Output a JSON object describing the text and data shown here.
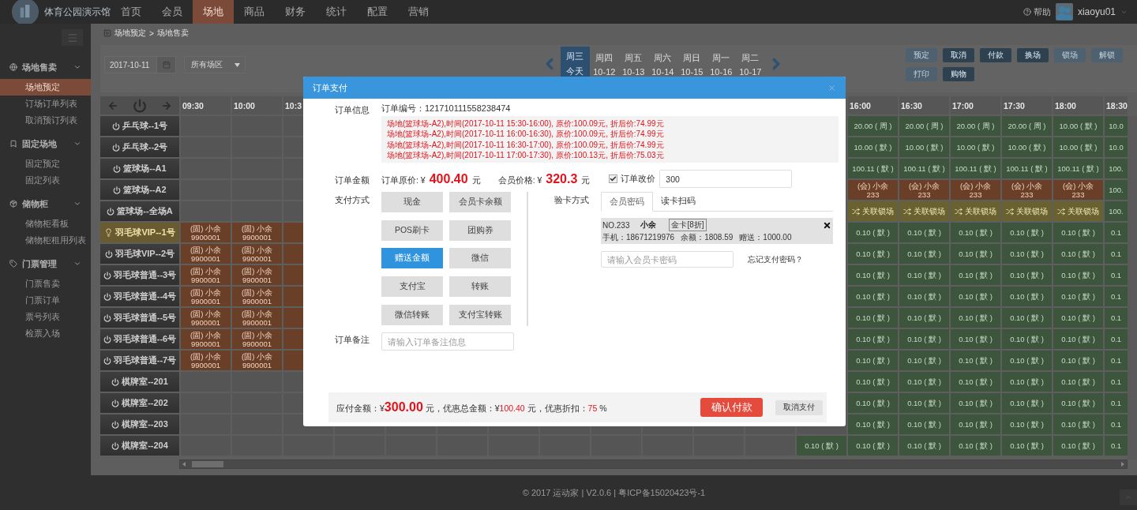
{
  "app": {
    "name": "体育公园演示馆"
  },
  "nav": [
    {
      "label": "首页",
      "selected": false
    },
    {
      "label": "会员",
      "selected": false
    },
    {
      "label": "场地",
      "selected": true
    },
    {
      "label": "商品",
      "selected": false
    },
    {
      "label": "财务",
      "selected": false
    },
    {
      "label": "统计",
      "selected": false
    },
    {
      "label": "配置",
      "selected": false
    },
    {
      "label": "营销",
      "selected": false
    }
  ],
  "user": {
    "help": "帮助",
    "name": "xiaoyu01"
  },
  "sidebar": {
    "groups": [
      {
        "label": "场地售卖",
        "expanded": true,
        "items": [
          {
            "label": "场地预定",
            "selected": true
          },
          {
            "label": "订场订单列表",
            "selected": false
          },
          {
            "label": "取消预订列表",
            "selected": false
          }
        ]
      },
      {
        "label": "固定场地",
        "expanded": true,
        "items": [
          {
            "label": "固定预定",
            "selected": false
          },
          {
            "label": "固定列表",
            "selected": false
          }
        ]
      },
      {
        "label": "储物柜",
        "expanded": true,
        "items": [
          {
            "label": "储物柜看板",
            "selected": false
          },
          {
            "label": "储物柜租用列表",
            "selected": false
          }
        ]
      },
      {
        "label": "门票管理",
        "expanded": true,
        "items": [
          {
            "label": "门票售卖",
            "selected": false
          },
          {
            "label": "门票订单",
            "selected": false
          },
          {
            "label": "票号列表",
            "selected": false
          },
          {
            "label": "检票入场",
            "selected": false
          }
        ]
      }
    ]
  },
  "breadcrumb": {
    "items": [
      "场地预定",
      "场地售卖"
    ],
    "separator": ">"
  },
  "toolbar": {
    "date": "2017-10-11",
    "area": "所有场区",
    "days": [
      {
        "weekday": "周三",
        "date": "今天",
        "selected": true
      },
      {
        "weekday": "周四",
        "date": "10-12",
        "selected": false
      },
      {
        "weekday": "周五",
        "date": "10-13",
        "selected": false
      },
      {
        "weekday": "周六",
        "date": "10-14",
        "selected": false
      },
      {
        "weekday": "周日",
        "date": "10-15",
        "selected": false
      },
      {
        "weekday": "周一",
        "date": "10-16",
        "selected": false
      },
      {
        "weekday": "周二",
        "date": "10-17",
        "selected": false
      }
    ],
    "buttons": [
      {
        "label": "预定",
        "disabled": true
      },
      {
        "label": "取消",
        "disabled": false
      },
      {
        "label": "付款",
        "disabled": false
      },
      {
        "label": "换场",
        "disabled": false
      },
      {
        "label": "锁场",
        "disabled": true
      },
      {
        "label": "解锁",
        "disabled": true
      },
      {
        "label": "打印",
        "disabled": true
      },
      {
        "label": "购物",
        "disabled": false
      }
    ]
  },
  "grid": {
    "columns": [
      "09:30",
      "10:00",
      "10:3",
      null,
      null,
      null,
      null,
      null,
      null,
      null,
      null,
      null,
      null,
      "16:00",
      "16:30",
      "17:00",
      "17:30",
      "18:00",
      "18:30"
    ],
    "rows": [
      {
        "name": "乒乓球--1号",
        "highlighted": false,
        "cells": [
          null,
          null,
          null,
          null,
          null,
          null,
          null,
          null,
          null,
          null,
          null,
          null,
          null,
          {
            "kind": "price",
            "text": "20.00 ( 周 )"
          },
          {
            "kind": "price",
            "text": "20.00 ( 周 )"
          },
          {
            "kind": "price",
            "text": "20.00 ( 周 )"
          },
          {
            "kind": "price",
            "text": "20.00 ( 周 )"
          },
          {
            "kind": "price",
            "text": "10.00 ( 默 )"
          },
          {
            "kind": "price",
            "text": "10.0"
          }
        ]
      },
      {
        "name": "乒乓球--2号",
        "highlighted": false,
        "cells": [
          null,
          null,
          null,
          null,
          null,
          null,
          null,
          null,
          null,
          null,
          null,
          null,
          null,
          {
            "kind": "price",
            "text": "10.00 ( 默 )"
          },
          {
            "kind": "price",
            "text": "10.00 ( 默 )"
          },
          {
            "kind": "price",
            "text": "10.00 ( 默 )"
          },
          {
            "kind": "price",
            "text": "10.00 ( 默 )"
          },
          {
            "kind": "price",
            "text": "10.00 ( 默 )"
          },
          {
            "kind": "price",
            "text": "10.0"
          }
        ]
      },
      {
        "name": "篮球场--A1",
        "highlighted": false,
        "cells": [
          null,
          null,
          null,
          null,
          null,
          null,
          null,
          null,
          null,
          null,
          null,
          null,
          null,
          {
            "kind": "price",
            "text": "100.11 ( 默 )"
          },
          {
            "kind": "price",
            "text": "100.11 ( 默 )"
          },
          {
            "kind": "price",
            "text": "100.11 ( 默 )"
          },
          {
            "kind": "price",
            "text": "100.11 ( 默 )"
          },
          {
            "kind": "price",
            "text": "100.11 ( 默 )"
          },
          {
            "kind": "price",
            "text": "100."
          }
        ]
      },
      {
        "name": "篮球场--A2",
        "highlighted": false,
        "cells": [
          null,
          null,
          null,
          null,
          null,
          null,
          null,
          null,
          null,
          null,
          null,
          null,
          null,
          {
            "kind": "booked",
            "lines": [
              "(会) 小余",
              "233"
            ]
          },
          {
            "kind": "booked",
            "lines": [
              "(会) 小余",
              "233"
            ]
          },
          {
            "kind": "booked",
            "lines": [
              "(会) 小余",
              "233"
            ]
          },
          {
            "kind": "booked",
            "lines": [
              "(会) 小余",
              "233"
            ]
          },
          {
            "kind": "booked",
            "lines": [
              "(会) 小余",
              "233"
            ]
          },
          {
            "kind": "price",
            "text": "100."
          }
        ]
      },
      {
        "name": "篮球场--全场A",
        "highlighted": false,
        "cells": [
          null,
          null,
          null,
          null,
          null,
          null,
          null,
          null,
          null,
          null,
          null,
          null,
          null,
          {
            "kind": "linked",
            "text": "关联锁场"
          },
          {
            "kind": "linked",
            "text": "关联锁场"
          },
          {
            "kind": "linked",
            "text": "关联锁场"
          },
          {
            "kind": "linked",
            "text": "关联锁场"
          },
          {
            "kind": "linked",
            "text": "关联锁场"
          },
          {
            "kind": "price",
            "text": "100."
          }
        ]
      },
      {
        "name": "羽毛球VIP--1号",
        "highlighted": true,
        "cells": [
          {
            "kind": "booked",
            "lines": [
              "(固) 小余",
              "9900001"
            ]
          },
          {
            "kind": "booked",
            "lines": [
              "(固) 小余",
              "9900001"
            ]
          },
          {
            "kind": "booked"
          },
          null,
          null,
          null,
          null,
          null,
          null,
          null,
          null,
          null,
          null,
          {
            "kind": "price",
            "text": "0.10 ( 默 )"
          },
          {
            "kind": "price",
            "text": "0.10 ( 默 )"
          },
          {
            "kind": "price",
            "text": "0.10 ( 默 )"
          },
          {
            "kind": "price",
            "text": "0.10 ( 默 )"
          },
          {
            "kind": "price",
            "text": "0.10 ( 默 )"
          },
          {
            "kind": "price",
            "text": "0.1"
          }
        ]
      },
      {
        "name": "羽毛球VIP--2号",
        "highlighted": false,
        "cells": [
          {
            "kind": "booked",
            "lines": [
              "(固) 小余",
              "9900001"
            ]
          },
          {
            "kind": "booked",
            "lines": [
              "(固) 小余",
              "9900001"
            ]
          },
          {
            "kind": "booked"
          },
          null,
          null,
          null,
          null,
          null,
          null,
          null,
          null,
          null,
          null,
          {
            "kind": "price",
            "text": "0.10 ( 默 )"
          },
          {
            "kind": "price",
            "text": "0.10 ( 默 )"
          },
          {
            "kind": "price",
            "text": "0.10 ( 默 )"
          },
          {
            "kind": "price",
            "text": "0.10 ( 默 )"
          },
          {
            "kind": "price",
            "text": "0.10 ( 默 )"
          },
          {
            "kind": "price",
            "text": "0.1"
          }
        ]
      },
      {
        "name": "羽毛球普通--3号",
        "highlighted": false,
        "cells": [
          {
            "kind": "booked",
            "lines": [
              "(固) 小余",
              "9900001"
            ]
          },
          {
            "kind": "booked",
            "lines": [
              "(固) 小余",
              "9900001"
            ]
          },
          {
            "kind": "booked"
          },
          null,
          null,
          null,
          null,
          null,
          null,
          null,
          null,
          null,
          null,
          {
            "kind": "price",
            "text": "0.10 ( 默 )"
          },
          {
            "kind": "price",
            "text": "0.10 ( 默 )"
          },
          {
            "kind": "price",
            "text": "0.10 ( 默 )"
          },
          {
            "kind": "price",
            "text": "0.10 ( 默 )"
          },
          {
            "kind": "price",
            "text": "0.10 ( 默 )"
          },
          {
            "kind": "price",
            "text": "0.1"
          }
        ]
      },
      {
        "name": "羽毛球普通--4号",
        "highlighted": false,
        "cells": [
          {
            "kind": "booked",
            "lines": [
              "(固) 小余",
              "9900001"
            ]
          },
          {
            "kind": "booked",
            "lines": [
              "(固) 小余",
              "9900001"
            ]
          },
          {
            "kind": "booked"
          },
          null,
          null,
          null,
          null,
          null,
          null,
          null,
          null,
          null,
          null,
          {
            "kind": "price",
            "text": "0.10 ( 默 )"
          },
          {
            "kind": "price",
            "text": "0.10 ( 默 )"
          },
          {
            "kind": "price",
            "text": "0.10 ( 默 )"
          },
          {
            "kind": "price",
            "text": "0.10 ( 默 )"
          },
          {
            "kind": "price",
            "text": "0.10 ( 默 )"
          },
          {
            "kind": "price",
            "text": "0.1"
          }
        ]
      },
      {
        "name": "羽毛球普通--5号",
        "highlighted": false,
        "cells": [
          {
            "kind": "booked",
            "lines": [
              "(固) 小余",
              "9900001"
            ]
          },
          {
            "kind": "booked",
            "lines": [
              "(固) 小余",
              "9900001"
            ]
          },
          {
            "kind": "booked"
          },
          null,
          null,
          null,
          null,
          null,
          null,
          null,
          null,
          null,
          null,
          {
            "kind": "price",
            "text": "0.10 ( 默 )"
          },
          {
            "kind": "price",
            "text": "0.10 ( 默 )"
          },
          {
            "kind": "price",
            "text": "0.10 ( 默 )"
          },
          {
            "kind": "price",
            "text": "0.10 ( 默 )"
          },
          {
            "kind": "price",
            "text": "0.10 ( 默 )"
          },
          {
            "kind": "price",
            "text": "0.1"
          }
        ]
      },
      {
        "name": "羽毛球普通--6号",
        "highlighted": false,
        "cells": [
          {
            "kind": "booked",
            "lines": [
              "(固) 小余",
              "9900001"
            ]
          },
          {
            "kind": "booked",
            "lines": [
              "(固) 小余",
              "9900001"
            ]
          },
          {
            "kind": "booked"
          },
          null,
          null,
          null,
          null,
          null,
          null,
          null,
          null,
          null,
          null,
          {
            "kind": "price",
            "text": "0.10 ( 默 )"
          },
          {
            "kind": "price",
            "text": "0.10 ( 默 )"
          },
          {
            "kind": "price",
            "text": "0.10 ( 默 )"
          },
          {
            "kind": "price",
            "text": "0.10 ( 默 )"
          },
          {
            "kind": "price",
            "text": "0.10 ( 默 )"
          },
          {
            "kind": "price",
            "text": "0.1"
          }
        ]
      },
      {
        "name": "羽毛球普通--7号",
        "highlighted": false,
        "cells": [
          {
            "kind": "booked",
            "lines": [
              "(固) 小余",
              "9900001"
            ]
          },
          {
            "kind": "booked",
            "lines": [
              "(固) 小余",
              "9900001"
            ]
          },
          {
            "kind": "booked"
          },
          null,
          null,
          null,
          null,
          null,
          null,
          null,
          null,
          null,
          null,
          {
            "kind": "price",
            "text": "0.10 ( 默 )"
          },
          {
            "kind": "price",
            "text": "0.10 ( 默 )"
          },
          {
            "kind": "price",
            "text": "0.10 ( 默 )"
          },
          {
            "kind": "price",
            "text": "0.10 ( 默 )"
          },
          {
            "kind": "price",
            "text": "0.10 ( 默 )"
          },
          {
            "kind": "price",
            "text": "0.1"
          }
        ]
      },
      {
        "name": "棋牌室--201",
        "highlighted": false,
        "cells": [
          null,
          null,
          null,
          null,
          null,
          null,
          null,
          null,
          null,
          null,
          null,
          null,
          null,
          {
            "kind": "price",
            "text": "0.10 ( 默 )"
          },
          {
            "kind": "price",
            "text": "0.10 ( 默 )"
          },
          {
            "kind": "price",
            "text": "0.10 ( 默 )"
          },
          {
            "kind": "price",
            "text": "0.10 ( 默 )"
          },
          {
            "kind": "price",
            "text": "0.10 ( 默 )"
          },
          {
            "kind": "price",
            "text": "0.1"
          }
        ]
      },
      {
        "name": "棋牌室--202",
        "highlighted": false,
        "cells": [
          null,
          null,
          null,
          null,
          null,
          null,
          null,
          null,
          null,
          null,
          null,
          null,
          null,
          {
            "kind": "price",
            "text": "0.10 ( 默 )"
          },
          {
            "kind": "price",
            "text": "0.10 ( 默 )"
          },
          {
            "kind": "price",
            "text": "0.10 ( 默 )"
          },
          {
            "kind": "price",
            "text": "0.10 ( 默 )"
          },
          {
            "kind": "price",
            "text": "0.10 ( 默 )"
          },
          {
            "kind": "price",
            "text": "0.1"
          }
        ]
      },
      {
        "name": "棋牌室--203",
        "highlighted": false,
        "cells": [
          null,
          null,
          null,
          null,
          null,
          null,
          null,
          null,
          null,
          null,
          null,
          null,
          null,
          {
            "kind": "price",
            "text": "0.10 ( 默 )"
          },
          {
            "kind": "price",
            "text": "0.10 ( 默 )"
          },
          {
            "kind": "price",
            "text": "0.10 ( 默 )"
          },
          {
            "kind": "price",
            "text": "0.10 ( 默 )"
          },
          {
            "kind": "price",
            "text": "0.10 ( 默 )"
          },
          {
            "kind": "price",
            "text": "0.1"
          }
        ]
      },
      {
        "name": "棋牌室--204",
        "highlighted": false,
        "cells": [
          null,
          null,
          null,
          null,
          null,
          null,
          null,
          null,
          null,
          null,
          null,
          null,
          {
            "kind": "price",
            "text": "0.10 ( 默 )"
          },
          {
            "kind": "price",
            "text": "0.10 ( 默 )"
          },
          {
            "kind": "price",
            "text": "0.10 ( 默 )"
          },
          {
            "kind": "price",
            "text": "0.10 ( 默 )"
          },
          {
            "kind": "price",
            "text": "0.10 ( 默 )"
          },
          {
            "kind": "price",
            "text": "0.10 ( 默 )"
          },
          {
            "kind": "price",
            "text": "0.1"
          }
        ]
      }
    ]
  },
  "modal": {
    "title": "订单支付",
    "info_label": "订单信息",
    "order_no": "订单编号：121710111558238474",
    "items": [
      "场地(篮球场-A2),时间(2017-10-11 15:30-16:00), 原价:100.09元, 折后价:74.99元",
      "场地(篮球场-A2),时间(2017-10-11 16:00-16:30), 原价:100.09元, 折后价:74.99元",
      "场地(篮球场-A2),时间(2017-10-11 16:30-17:00), 原价:100.09元, 折后价:74.99元",
      "场地(篮球场-A2),时间(2017-10-11 17:00-17:30), 原价:100.13元, 折后价:75.03元"
    ],
    "amount_label": "订单金额",
    "original": {
      "label": "订单原价: ¥",
      "value": "400.40",
      "unit": "元"
    },
    "member": {
      "label": "会员价格: ¥",
      "value": "320.3",
      "unit": "元"
    },
    "adjust": {
      "label": "订单改价",
      "checked": true,
      "value": "300"
    },
    "pay_label": "支付方式",
    "methods": [
      {
        "label": "现金",
        "selected": false
      },
      {
        "label": "会员卡余额",
        "selected": false
      },
      {
        "label": "POS刷卡",
        "selected": false
      },
      {
        "label": "团购券",
        "selected": false
      },
      {
        "label": "赠送金额",
        "selected": true
      },
      {
        "label": "微信",
        "selected": false
      },
      {
        "label": "支付宝",
        "selected": false
      },
      {
        "label": "转账",
        "selected": false
      },
      {
        "label": "微信转账",
        "selected": false
      },
      {
        "label": "支付宝转账",
        "selected": false
      }
    ],
    "verify": {
      "label": "验卡方式",
      "tabs": [
        {
          "label": "会员密码",
          "selected": true
        },
        {
          "label": "读卡扫码",
          "selected": false
        }
      ],
      "card": {
        "no": "NO.233",
        "name": "小余",
        "grade": "金卡[8折]",
        "phone": "手机：18671219976",
        "balance": "余额：1808.59",
        "gift": "赠送：1000.00"
      },
      "password_placeholder": "请输入会员卡密码",
      "forgot": "忘记支付密码？"
    },
    "remark": {
      "label": "订单备注",
      "placeholder": "请输入订单备注信息"
    },
    "summary": [
      {
        "kind": "plain",
        "text": "应付金额：¥"
      },
      {
        "kind": "big",
        "text": "300.00"
      },
      {
        "kind": "plain",
        "text": " 元，优惠总金额：¥"
      },
      {
        "kind": "red",
        "text": "100.40"
      },
      {
        "kind": "plain",
        "text": " 元，优惠折扣："
      },
      {
        "kind": "red",
        "text": "75"
      },
      {
        "kind": "plain",
        "text": " %"
      }
    ],
    "confirm": "确认付款",
    "cancel": "取消支付"
  },
  "footer": "© 2017 运动家 | V2.0.6 | 粤ICP备15020423号-1"
}
